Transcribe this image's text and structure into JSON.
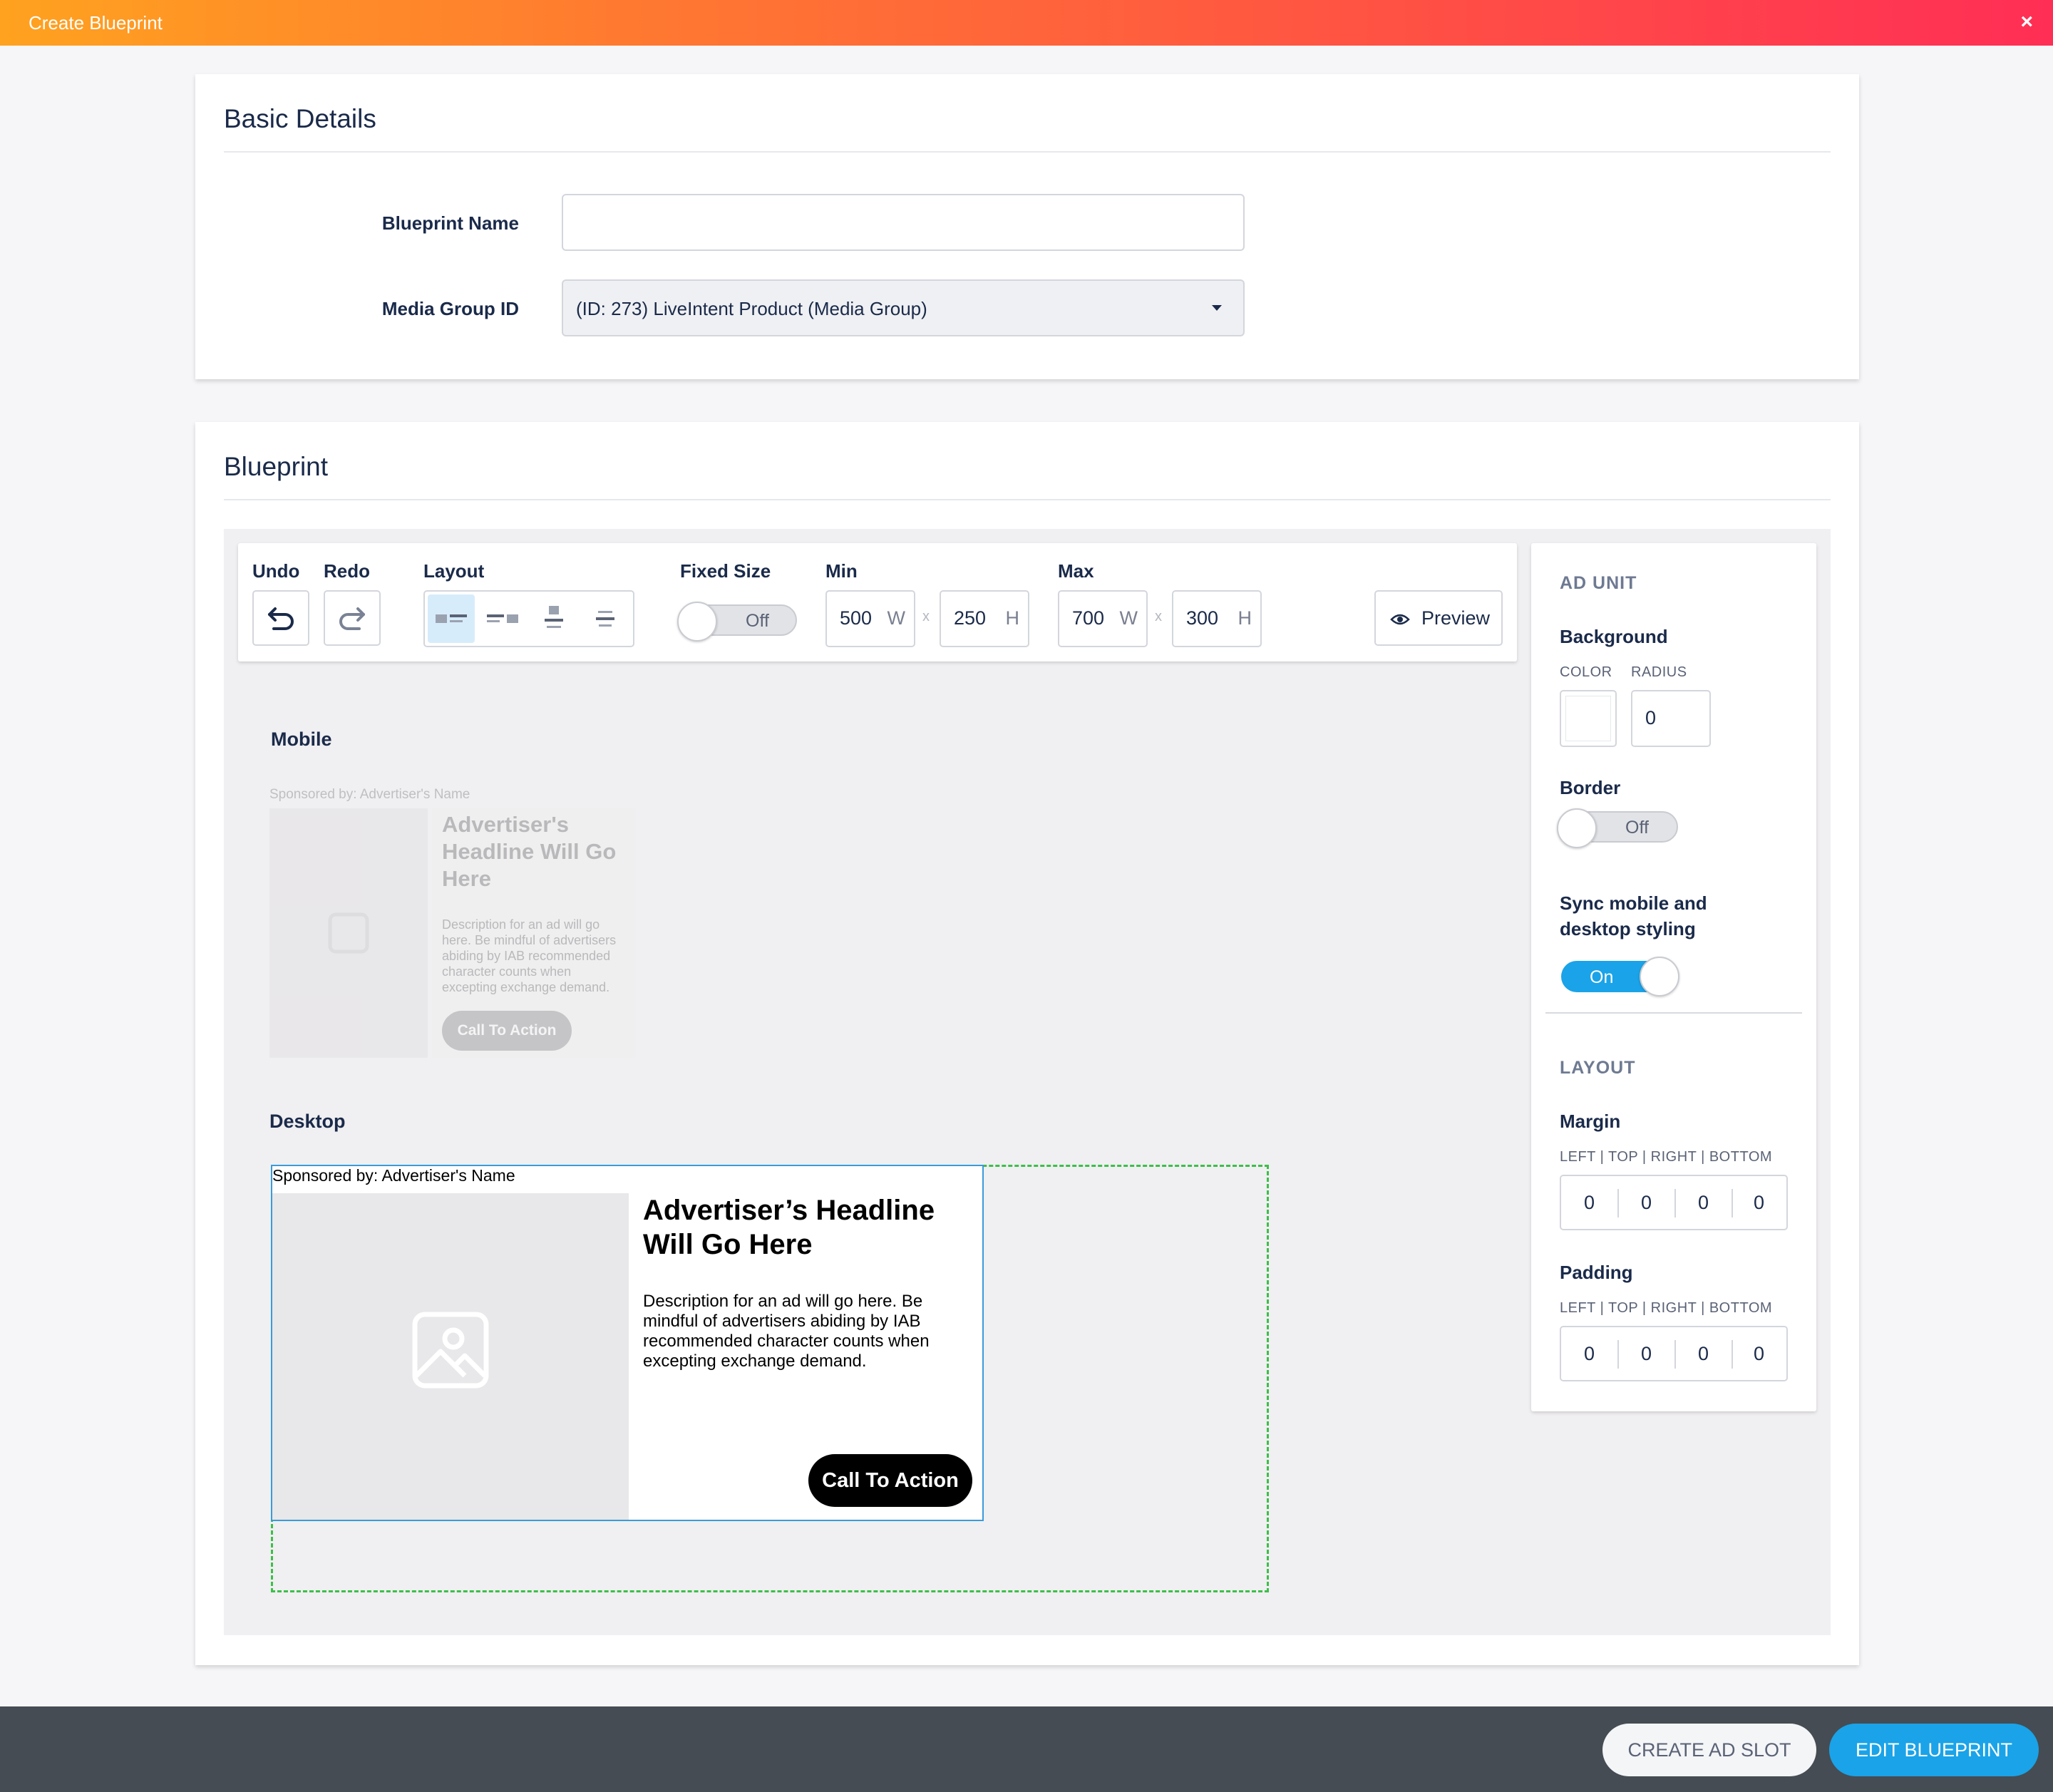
{
  "window": {
    "title": "Create Blueprint",
    "close_symbol": "×"
  },
  "basic_details": {
    "title": "Basic Details",
    "blueprint_name_label": "Blueprint Name",
    "blueprint_name_value": "",
    "media_group_label": "Media Group ID",
    "media_group_value": "(ID: 273) LiveIntent Product (Media Group)"
  },
  "blueprint": {
    "title": "Blueprint",
    "toolbar": {
      "undo_label": "Undo",
      "redo_label": "Redo",
      "layout_label": "Layout",
      "layout_options": [
        "layout-left-image",
        "layout-right-image",
        "layout-top-image",
        "layout-text-only"
      ],
      "fixed_size_label": "Fixed Size",
      "fixed_size_state": "Off",
      "min_label": "Min",
      "min_w": "500",
      "min_h": "250",
      "max_label": "Max",
      "max_w": "700",
      "max_h": "300",
      "w_unit": "W",
      "h_unit": "H",
      "x_sep": "x",
      "preview_label": "Preview"
    },
    "mobile_label": "Mobile",
    "desktop_label": "Desktop",
    "ad": {
      "sponsored": "Sponsored by: Advertiser's Name",
      "headline": "Advertiser’s Headline Will Go Here",
      "mobile_headline": "Advertiser's Headline Will Go Here",
      "description": "Description for an ad will go here. Be mindful of advertisers abiding by IAB recommended character counts when excepting exchange demand.",
      "cta": "Call To Action"
    }
  },
  "side_panel": {
    "ad_unit_heading": "AD UNIT",
    "background_label": "Background",
    "color_label": "COLOR",
    "radius_label": "RADIUS",
    "radius_value": "0",
    "background_color": "#ffffff",
    "border_label": "Border",
    "border_state": "Off",
    "sync_label_line1": "Sync mobile and",
    "sync_label_line2": "desktop styling",
    "sync_state": "On",
    "layout_heading": "LAYOUT",
    "margin_label": "Margin",
    "margin_sub": "LEFT | TOP | RIGHT | BOTTOM",
    "margin_values": [
      "0",
      "0",
      "0",
      "0"
    ],
    "padding_label": "Padding",
    "padding_sub": "LEFT | TOP | RIGHT | BOTTOM",
    "padding_values": [
      "0",
      "0",
      "0",
      "0"
    ]
  },
  "footer": {
    "create_ad_slot": "CREATE AD SLOT",
    "edit_blueprint": "EDIT BLUEPRINT"
  },
  "colors": {
    "accent": "#1aa3e8",
    "dark": "#1a2a4a",
    "footer": "#454c53"
  }
}
